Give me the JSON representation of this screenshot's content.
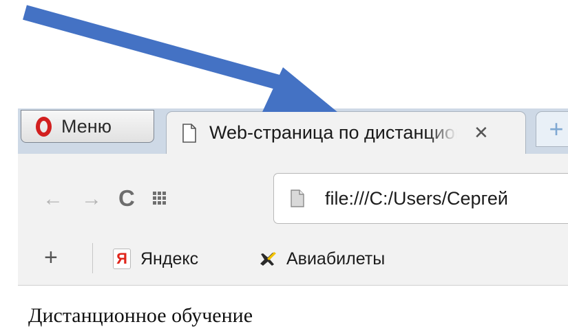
{
  "annotation": {
    "arrow_color": "#4472c4"
  },
  "tabstrip": {
    "menu_label": "Меню",
    "active_tab_title": "Web-страница по дистанционному обучению",
    "close_glyph": "✕",
    "new_tab_glyph": "+"
  },
  "toolbar": {
    "back_glyph": "←",
    "forward_glyph": "→",
    "reload_glyph": "C",
    "address": "file:///C:/Users/Сергей"
  },
  "bookmarks": {
    "add_glyph": "+",
    "items": [
      {
        "icon": "yandex-icon",
        "icon_text": "Я",
        "label": "Яндекс"
      },
      {
        "icon": "plane-icon",
        "label": "Авиабилеты"
      }
    ]
  },
  "page": {
    "heading": "Дистанционное обучение"
  },
  "icons": [
    "opera-logo",
    "page-icon",
    "close-icon",
    "new-tab-icon",
    "back-icon",
    "forward-icon",
    "reload-icon",
    "speed-dial-icon",
    "document-icon",
    "yandex-icon",
    "plane-icon"
  ]
}
